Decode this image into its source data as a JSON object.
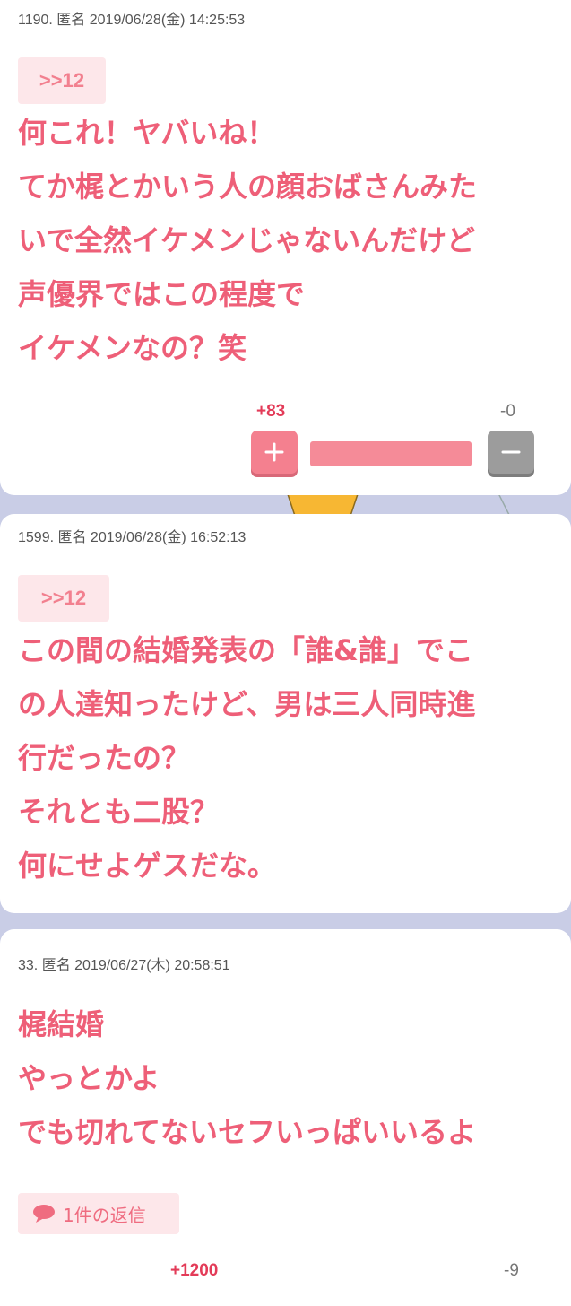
{
  "comments": [
    {
      "meta": "1190. 匿名 2019/06/28(金) 14:25:53",
      "anchor": ">>12",
      "lines": [
        "何これ！ヤバいね！",
        "てか梶とかいう人の顔おばさんみた",
        "いで全然イケメンじゃないんだけど",
        "声優界ではこの程度で",
        "イケメンなの？笑"
      ],
      "votes": {
        "plus": "+83",
        "minus": "-0",
        "plus_ratio": 1.0
      }
    },
    {
      "meta": "1599. 匿名 2019/06/28(金) 16:52:13",
      "anchor": ">>12",
      "lines": [
        "この間の結婚発表の「誰&誰」でこ",
        "の人達知ったけど、男は三人同時進",
        "行だったの？",
        "それとも二股？",
        "何にせよゲスだな。"
      ]
    },
    {
      "meta": "33. 匿名 2019/06/27(木) 20:58:51",
      "lines": [
        "梶結婚",
        "やっとかよ",
        "でも切れてないセフいっぱいいるよ"
      ],
      "reply": {
        "label": "1件の返信",
        "icon": "speech-bubble-icon"
      },
      "votes": {
        "plus": "+1200",
        "minus": "-9"
      }
    }
  ],
  "colors": {
    "accent": "#ee5f78",
    "plus": "#f4808f",
    "minus": "#9c9c9c",
    "anchor_bg": "#fde7ea",
    "page_bg": "#c9cde6"
  }
}
